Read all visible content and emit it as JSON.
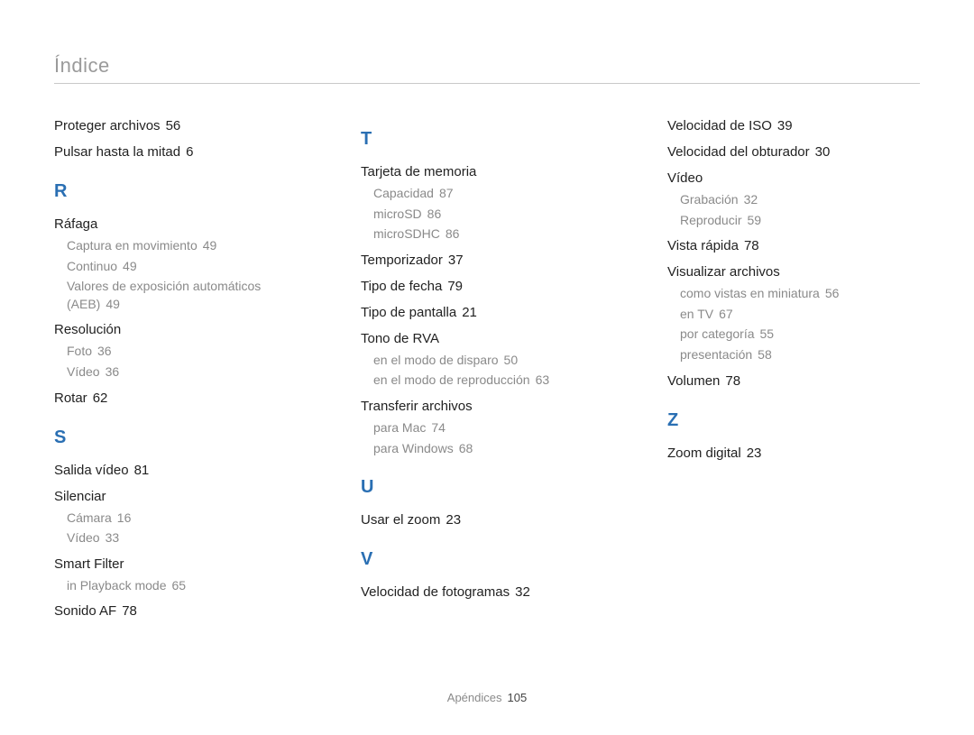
{
  "header": {
    "title": "Índice"
  },
  "footer": {
    "label": "Apéndices",
    "page": "105"
  },
  "columns": [
    {
      "blocks": [
        {
          "type": "entry",
          "label": "Proteger archivos",
          "page": "56"
        },
        {
          "type": "entry",
          "label": "Pulsar hasta la mitad",
          "page": "6"
        },
        {
          "type": "letter",
          "label": "R"
        },
        {
          "type": "entry",
          "label": "Ráfaga"
        },
        {
          "type": "sub",
          "label": "Captura en movimiento",
          "page": "49"
        },
        {
          "type": "sub",
          "label": "Continuo",
          "page": "49"
        },
        {
          "type": "sub",
          "label": "Valores de exposición automáticos (AEB)",
          "page": "49"
        },
        {
          "type": "entry",
          "label": "Resolución"
        },
        {
          "type": "sub",
          "label": "Foto",
          "page": "36"
        },
        {
          "type": "sub",
          "label": "Vídeo",
          "page": "36"
        },
        {
          "type": "entry",
          "label": "Rotar",
          "page": "62"
        },
        {
          "type": "letter",
          "label": "S"
        },
        {
          "type": "entry",
          "label": "Salida vídeo",
          "page": "81"
        },
        {
          "type": "entry",
          "label": "Silenciar"
        },
        {
          "type": "sub",
          "label": "Cámara",
          "page": "16"
        },
        {
          "type": "sub",
          "label": "Vídeo",
          "page": "33"
        },
        {
          "type": "entry",
          "label": "Smart Filter"
        },
        {
          "type": "sub",
          "label": "in Playback mode",
          "page": "65"
        },
        {
          "type": "entry",
          "label": "Sonido AF",
          "page": "78"
        }
      ]
    },
    {
      "blocks": [
        {
          "type": "letter",
          "label": "T"
        },
        {
          "type": "entry",
          "label": "Tarjeta de memoria"
        },
        {
          "type": "sub",
          "label": "Capacidad",
          "page": "87"
        },
        {
          "type": "sub",
          "label": "microSD",
          "page": "86"
        },
        {
          "type": "sub",
          "label": "microSDHC",
          "page": "86"
        },
        {
          "type": "entry",
          "label": "Temporizador",
          "page": "37"
        },
        {
          "type": "entry",
          "label": "Tipo de fecha",
          "page": "79"
        },
        {
          "type": "entry",
          "label": "Tipo de pantalla",
          "page": "21"
        },
        {
          "type": "entry",
          "label": "Tono de RVA"
        },
        {
          "type": "sub",
          "label": "en el modo de disparo",
          "page": "50"
        },
        {
          "type": "sub",
          "label": "en el modo de reproducción",
          "page": "63"
        },
        {
          "type": "entry",
          "label": "Transferir archivos"
        },
        {
          "type": "sub",
          "label": "para Mac",
          "page": "74"
        },
        {
          "type": "sub",
          "label": "para Windows",
          "page": "68"
        },
        {
          "type": "letter",
          "label": "U"
        },
        {
          "type": "entry",
          "label": "Usar el zoom",
          "page": "23"
        },
        {
          "type": "letter",
          "label": "V"
        },
        {
          "type": "entry",
          "label": "Velocidad de fotogramas",
          "page": "32"
        }
      ]
    },
    {
      "blocks": [
        {
          "type": "entry",
          "label": "Velocidad de ISO",
          "page": "39"
        },
        {
          "type": "entry",
          "label": "Velocidad del obturador",
          "page": "30"
        },
        {
          "type": "entry",
          "label": "Vídeo"
        },
        {
          "type": "sub",
          "label": "Grabación",
          "page": "32"
        },
        {
          "type": "sub",
          "label": "Reproducir",
          "page": "59"
        },
        {
          "type": "entry",
          "label": "Vista rápida",
          "page": "78"
        },
        {
          "type": "entry",
          "label": "Visualizar archivos"
        },
        {
          "type": "sub",
          "label": "como vistas en miniatura",
          "page": "56"
        },
        {
          "type": "sub",
          "label": "en TV",
          "page": "67"
        },
        {
          "type": "sub",
          "label": "por categoría",
          "page": "55"
        },
        {
          "type": "sub",
          "label": "presentación",
          "page": "58"
        },
        {
          "type": "entry",
          "label": "Volumen",
          "page": "78"
        },
        {
          "type": "letter",
          "label": "Z"
        },
        {
          "type": "entry",
          "label": "Zoom digital",
          "page": "23"
        }
      ]
    }
  ]
}
